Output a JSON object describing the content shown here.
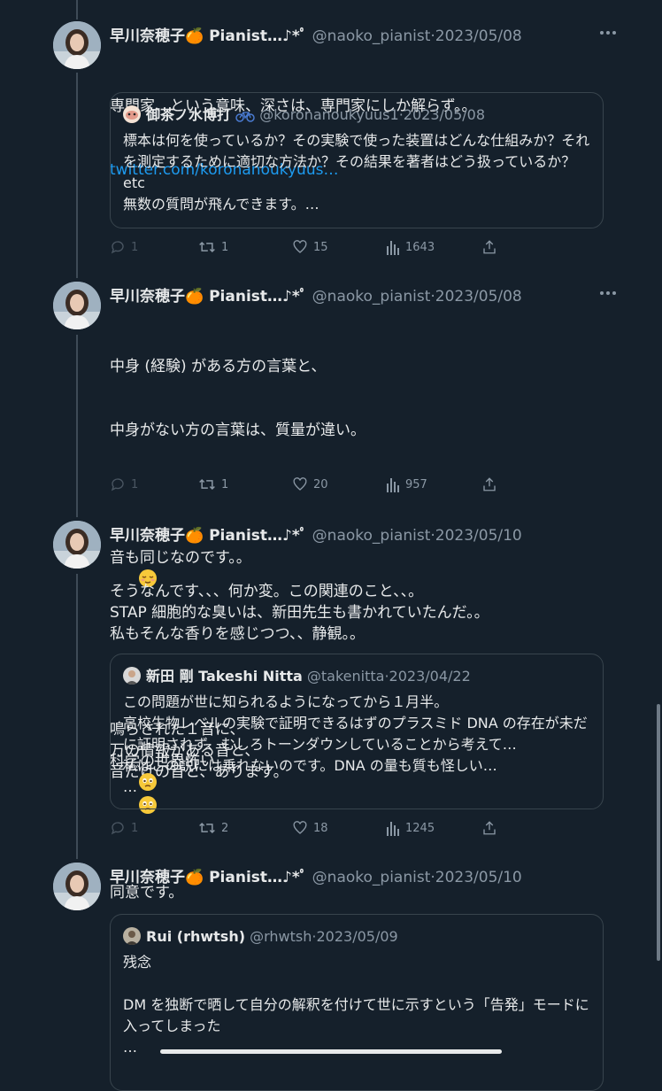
{
  "colors": {
    "background": "#15202b",
    "text": "#e7e9ea",
    "muted": "#8b98a5",
    "link": "#1d9bf0",
    "border": "#38444d"
  },
  "author": {
    "name": "早川奈穂子🍊 Pianist…♪*ﾟ",
    "handle": "@naoko_pianist",
    "avatar_icon": "woman-portrait-avatar"
  },
  "tweets": [
    {
      "date": "2023/05/08",
      "text": "専門家、という意味、深さは、専門家にしか解らず。。",
      "link": "twitter.com/koronanoukyuus…",
      "quote": {
        "name": "御茶ノ水博打",
        "name_suffix_icon": "bicycle-icon",
        "handle": "@koronanoukyuus1",
        "date": "2023/05/08",
        "text": "標本は何を使っているか？その実験で使った装置はどんな仕組みか？それを測定するために適切な方法か？その結果を著者はどう扱っているか？etc\n無数の質問が飛んできます。…"
      },
      "stats": {
        "replies": "1",
        "retweets": "1",
        "likes": "15",
        "views": "1643"
      }
    },
    {
      "date": "2023/05/08",
      "text_lines": [
        "中身 (経験) がある方の言葉と、",
        "中身がない方の言葉は、質量が違い。",
        "",
        "音も同じなのです。。"
      ],
      "text_after": "鳴らされた１音に、\n万の情報がある音と、\n音だけの音と、あります。",
      "emoji": "relieved-face-emoji",
      "stats": {
        "replies": "1",
        "retweets": "1",
        "likes": "20",
        "views": "957"
      }
    },
    {
      "date": "2023/05/10",
      "text": "そうなんです、、、何か変。この関連のこと、、。\nSTAP 細胞的な臭いは、新田先生も書かれていたんだ。。\n私もそんな香りを感じつつ、、静観。。",
      "text2": "科学の世界怖い",
      "emoji": "face-holding-back-tears-emoji",
      "quote": {
        "name": "新田 剛 Takeshi Nitta",
        "handle": "@takenitta",
        "date": "2023/04/22",
        "text": "この問題が世に知られるようになってから１月半。\n高校生物レベルの実験で証明できるはずのプラスミド DNA の存在が未だに証明されず、むしろトーンダウンしていることから考えて…\n私はこの説には乗れないのです。DNA の量も質も怪しい…\n…"
      },
      "stats": {
        "replies": "1",
        "retweets": "2",
        "likes": "18",
        "views": "1245"
      }
    },
    {
      "date": "2023/05/10",
      "text": "同意です。",
      "quote": {
        "name": "Rui (rhwtsh)",
        "handle": "@rhwtsh",
        "date": "2023/05/09",
        "text": "残念\n\nDM を独断で晒して自分の解釈を付けて世に示すという「告発」モードに入ってしまった\n…"
      }
    }
  ]
}
